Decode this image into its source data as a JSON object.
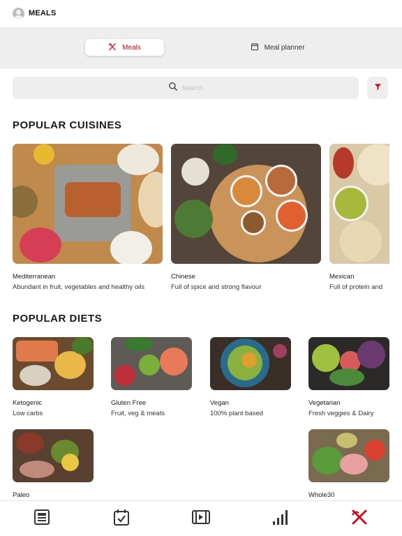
{
  "header": {
    "title": "MEALS",
    "avatar_icon": "user-avatar-icon"
  },
  "segments": [
    {
      "label": "Meals",
      "icon": "fork-knife-icon",
      "active": true
    },
    {
      "label": "Meal planner",
      "icon": "calendar-icon",
      "active": false
    }
  ],
  "search": {
    "placeholder": "Search",
    "filter_icon": "filter-icon"
  },
  "cuisines": {
    "title": "POPULAR CUISINES",
    "items": [
      {
        "name": "Mediterranean",
        "desc": "Abundant in fruit, vegetables and healthy oils"
      },
      {
        "name": "Chinese",
        "desc": "Full of spice and strong flavour"
      },
      {
        "name": "Mexican",
        "desc": "Full of protein and"
      }
    ]
  },
  "diets": {
    "title": "POPULAR DIETS",
    "items": [
      {
        "name": "Ketogenic",
        "desc": "Low carbs"
      },
      {
        "name": "Gluten Free",
        "desc": "Fruit, veg & meats"
      },
      {
        "name": "Vegan",
        "desc": "100% plant based"
      },
      {
        "name": "Vegetarian",
        "desc": "Fresh veggies & Dairy"
      },
      {
        "name": "Paleo",
        "desc": ""
      },
      {
        "name": "Whole30",
        "desc": ""
      }
    ]
  },
  "tabbar": {
    "items": [
      "news-icon",
      "checklist-icon",
      "video-icon",
      "stats-icon",
      "meals-icon"
    ],
    "active": "meals-icon"
  },
  "colors": {
    "accent": "#d0021b",
    "background": "#eeeeee"
  }
}
